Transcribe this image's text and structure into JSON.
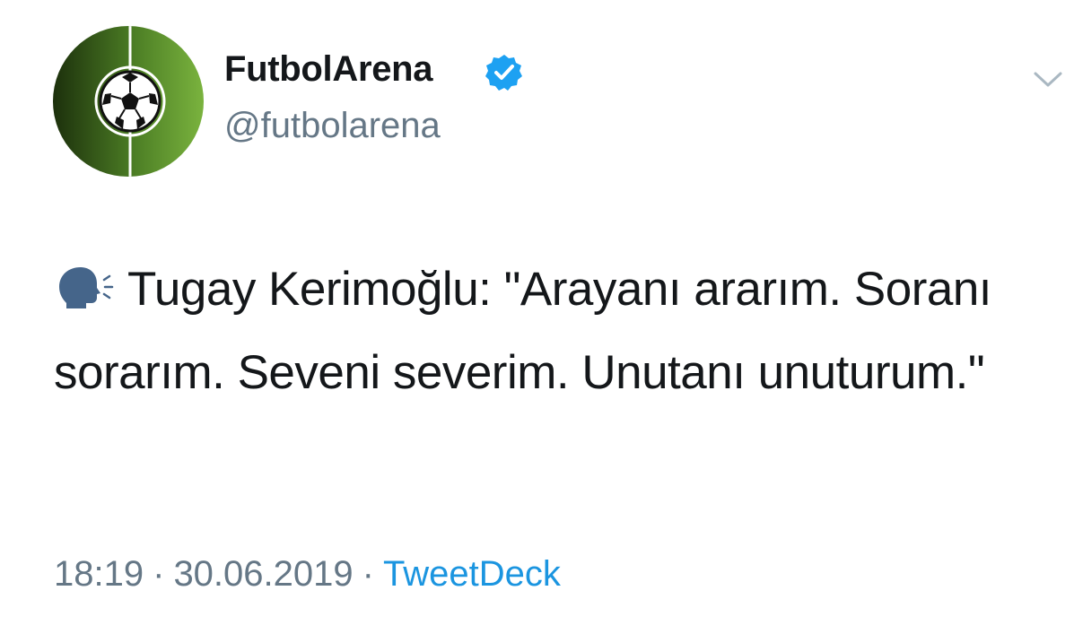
{
  "author": {
    "display_name": "FutbolArena",
    "handle": "@futbolarena",
    "verified": true,
    "avatar_icon": "soccer-ball-on-pitch-icon"
  },
  "tweet": {
    "leading_emoji": "speaking-head-icon",
    "text": "Tugay Kerimoğlu: \"Arayanı ararım. Soranı sorarım. Seveni severim. Unutanı unuturum.\""
  },
  "meta": {
    "time": "18:19",
    "separator": "·",
    "date": "30.06.2019",
    "source": "TweetDeck"
  },
  "colors": {
    "text": "#14171a",
    "secondary": "#657786",
    "link": "#1b95e0",
    "verified": "#1da1f2",
    "avatar_green_dark": "#1f3a0f",
    "avatar_green_light": "#6ea83a"
  }
}
